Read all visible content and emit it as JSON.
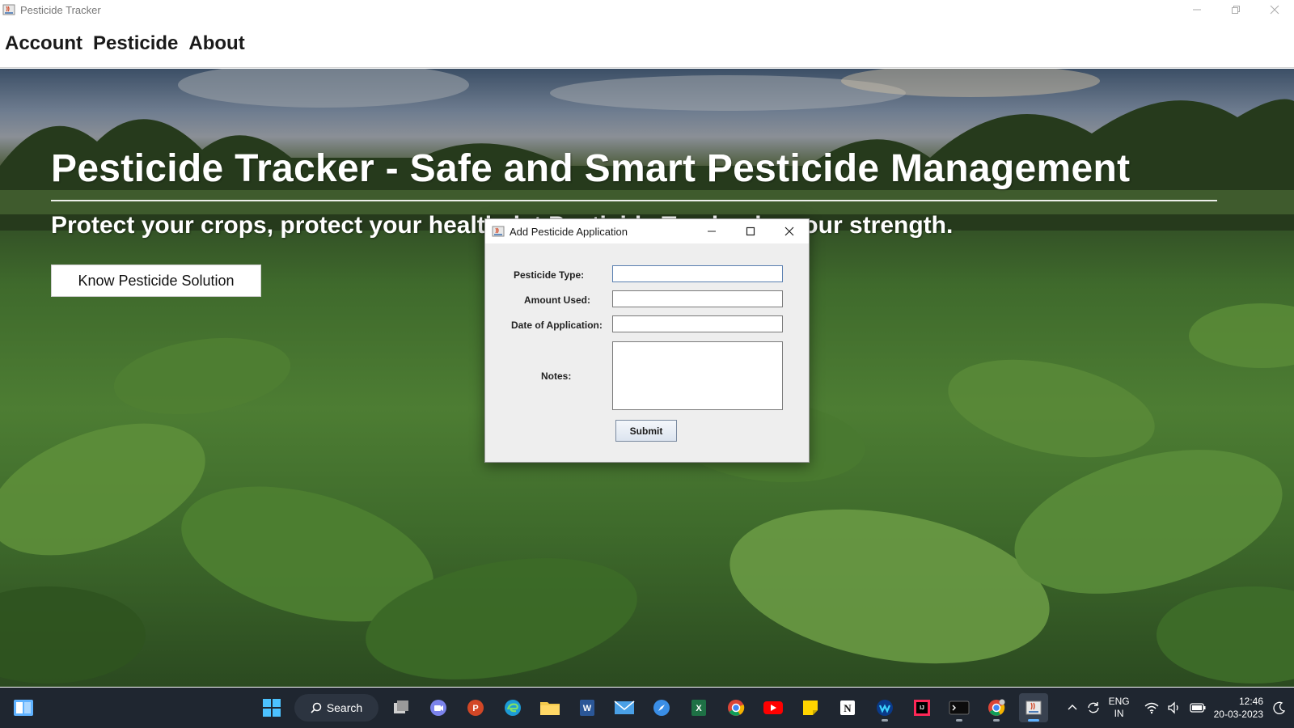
{
  "window": {
    "title": "Pesticide Tracker"
  },
  "menubar": {
    "items": [
      "Account",
      "Pesticide",
      "About"
    ]
  },
  "hero": {
    "title": "Pesticide Tracker - Safe and Smart Pesticide Management",
    "subtitle": "Protect your crops, protect your health, let Pesticide Tracker be your strength.",
    "button_label": "Know Pesticide Solution"
  },
  "dialog": {
    "title": "Add Pesticide Application",
    "fields": {
      "pesticide_type_label": "Pesticide Type:",
      "pesticide_type_value": "",
      "amount_used_label": "Amount Used:",
      "amount_used_value": "",
      "date_label": "Date of Application:",
      "date_value": "",
      "notes_label": "Notes:",
      "notes_value": ""
    },
    "submit_label": "Submit"
  },
  "taskbar": {
    "search_label": "Search",
    "pinned": [
      "task-view",
      "teams-chat",
      "powerpoint",
      "edge",
      "file-explorer",
      "word",
      "mail",
      "browser-compass",
      "excel",
      "chrome",
      "youtube",
      "sticky-notes",
      "notion",
      "webex",
      "intellij",
      "terminal",
      "chrome-profile",
      "java-app"
    ],
    "lang_line1": "ENG",
    "lang_line2": "IN",
    "time": "12:46",
    "date": "20-03-2023"
  },
  "colors": {
    "menubar_text": "#1a1a1a",
    "hero_text": "#ffffff",
    "dialog_bg": "#eeeeee",
    "taskbar_bg": "#1f2630",
    "accent": "#5fb2ff"
  }
}
